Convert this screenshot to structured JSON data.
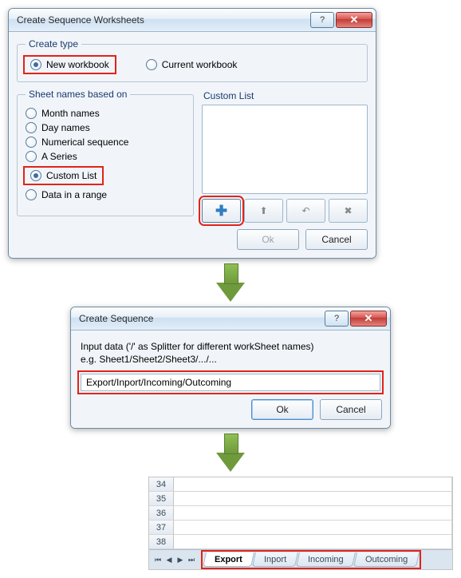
{
  "dialog1": {
    "title": "Create Sequence Worksheets",
    "create_type": {
      "legend": "Create type",
      "options": {
        "new_workbook": "New workbook",
        "current_workbook": "Current workbook"
      },
      "selected": "new_workbook"
    },
    "sheet_names": {
      "legend": "Sheet names based on",
      "options": {
        "month": "Month names",
        "day": "Day names",
        "numseq": "Numerical sequence",
        "aseries": "A Series",
        "custom": "Custom List",
        "range": "Data in a range"
      },
      "selected": "custom"
    },
    "custom_list": {
      "legend": "Custom List",
      "toolbar": {
        "add": "add-icon",
        "up": "arrow-up-icon",
        "undo": "undo-icon",
        "delete": "x-icon"
      }
    },
    "footer": {
      "ok": "Ok",
      "cancel": "Cancel"
    }
  },
  "dialog2": {
    "title": "Create Sequence",
    "instruction_line1": "Input data ('/' as Splitter for different workSheet names)",
    "instruction_line2": "e.g. Sheet1/Sheet2/Sheet3/.../...",
    "input_value": "Export/Inport/Incoming/Outcoming",
    "footer": {
      "ok": "Ok",
      "cancel": "Cancel"
    }
  },
  "spreadsheet": {
    "rows": [
      "34",
      "35",
      "36",
      "37",
      "38"
    ],
    "tabs": [
      "Export",
      "Inport",
      "Incoming",
      "Outcoming"
    ],
    "active_tab": "Export"
  }
}
